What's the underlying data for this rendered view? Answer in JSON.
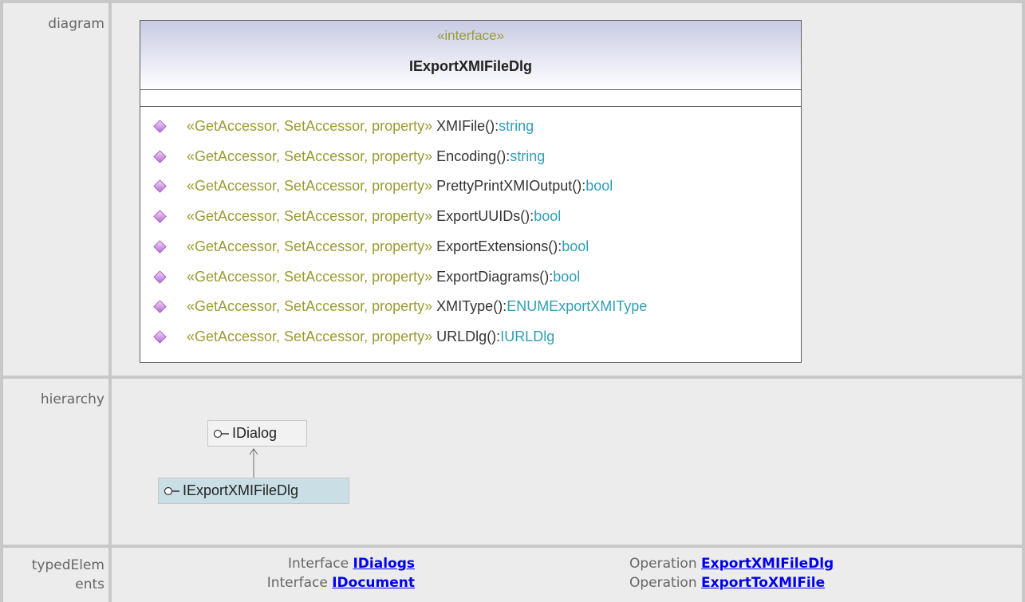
{
  "rows": {
    "diagram_label": "diagram",
    "hierarchy_label": "hierarchy",
    "typed_label_line1": "typedElem",
    "typed_label_line2": "ents"
  },
  "uml": {
    "stereotype": "«interface»",
    "class_name": "IExportXMIFileDlg",
    "operations": [
      {
        "stereotype": "«GetAccessor, SetAccessor, property»",
        "name": "XMIFile():",
        "type": "string"
      },
      {
        "stereotype": "«GetAccessor, SetAccessor, property»",
        "name": "Encoding():",
        "type": "string"
      },
      {
        "stereotype": "«GetAccessor, SetAccessor, property»",
        "name": "PrettyPrintXMIOutput():",
        "type": "bool"
      },
      {
        "stereotype": "«GetAccessor, SetAccessor, property»",
        "name": "ExportUUIDs():",
        "type": "bool"
      },
      {
        "stereotype": "«GetAccessor, SetAccessor, property»",
        "name": "ExportExtensions():",
        "type": "bool"
      },
      {
        "stereotype": "«GetAccessor, SetAccessor, property»",
        "name": "ExportDiagrams():",
        "type": "bool"
      },
      {
        "stereotype": "«GetAccessor, SetAccessor, property»",
        "name": "XMIType():",
        "type": "ENUMExportXMIType"
      },
      {
        "stereotype": "«GetAccessor, SetAccessor, property»",
        "name": "URLDlg():",
        "type": "IURLDlg"
      }
    ],
    "operation_icon": "operation-diamond-icon",
    "colors": {
      "stereotype": "#9b9b34",
      "type": "#2f9fb4",
      "icon": "#c77fd8"
    }
  },
  "hierarchy": {
    "parent": "IDialog",
    "child": "IExportXMIFileDlg",
    "interface_icon": "interface-lollipop-icon"
  },
  "typed_elements": [
    {
      "kind": "Interface",
      "name": "IDialogs"
    },
    {
      "kind": "Interface",
      "name": "IDocument"
    },
    {
      "kind": "Operation",
      "name": "ExportXMIFileDlg"
    },
    {
      "kind": "Operation",
      "name": "ExportToXMIFile"
    }
  ]
}
